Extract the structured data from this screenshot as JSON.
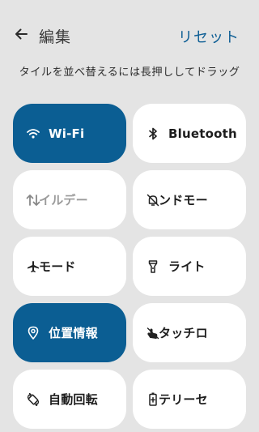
{
  "header": {
    "back_icon": "arrow-left-icon",
    "title": "編集",
    "reset_label": "リセット"
  },
  "hint_text": "タイルを並べ替えるには長押ししてドラッグ",
  "tiles": [
    {
      "label": "Wi-Fi",
      "icon": "wifi-icon",
      "active": true
    },
    {
      "label": "Bluetooth",
      "icon": "bluetooth-icon",
      "active": false
    },
    {
      "label": "イルデー",
      "icon": "data-transfer-icon",
      "active": false
    },
    {
      "label": "ンドモー",
      "icon": "do-not-disturb-off-icon",
      "active": false
    },
    {
      "label": "モード",
      "icon": "airplane-icon",
      "active": false
    },
    {
      "label": "ライト",
      "icon": "flashlight-icon",
      "active": false
    },
    {
      "label": "位置情報",
      "icon": "location-icon",
      "active": true
    },
    {
      "label": "タッチロ",
      "icon": "touch-lock-icon",
      "active": false
    },
    {
      "label": "自動回転",
      "icon": "auto-rotate-icon",
      "active": false
    },
    {
      "label": "テリーセ",
      "icon": "battery-saver-icon",
      "active": false
    }
  ],
  "colors": {
    "background": "#e4e4e4",
    "accent": "#0b5e93",
    "tile": "#ffffff"
  }
}
